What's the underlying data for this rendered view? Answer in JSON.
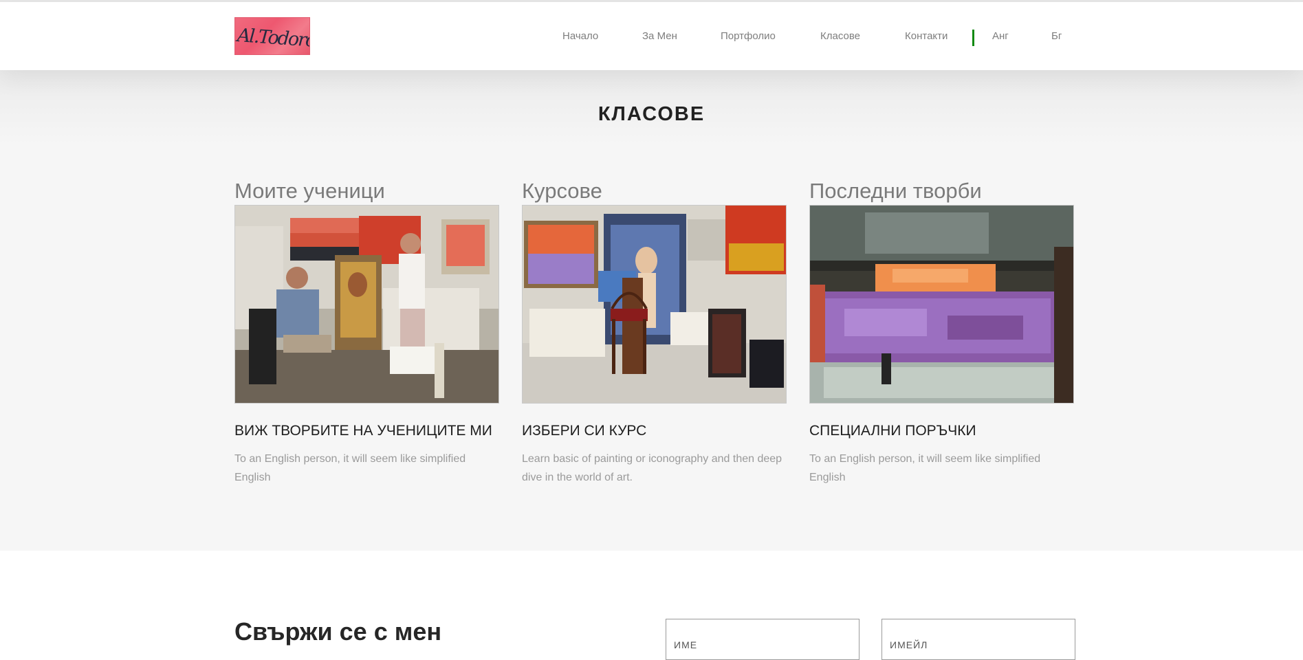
{
  "header": {
    "logo_text": "Al.Todorov",
    "nav": [
      "Начало",
      "За Мен",
      "Портфолио",
      "Класове",
      "Контакти",
      "Анг",
      "Бг"
    ]
  },
  "classes": {
    "title": "КЛАСОВЕ",
    "cards": [
      {
        "title": "Моите ученици",
        "image": "students-studio-photo",
        "heading": "ВИЖ ТВОРБИТЕ НА УЧЕНИЦИТЕ МИ",
        "text": "To an English person, it will seem like simplified English"
      },
      {
        "title": "Курсове",
        "image": "art-studio-photo",
        "heading": "ИЗБЕРИ СИ КУРС",
        "text": "Learn basic of painting or iconography and then deep dive in the world of art."
      },
      {
        "title": "Последни творби",
        "image": "abstract-painting-photo",
        "heading": "СПЕЦИАЛНИ ПОРЪЧКИ",
        "text": "To an English person, it will seem like simplified English"
      }
    ]
  },
  "contact": {
    "title": "Свържи се с мен",
    "name_placeholder": "ИМЕ",
    "email_placeholder": "ИМЕЙЛ"
  },
  "colors": {
    "nav_separator": "#108a10",
    "section_background": "#f6f6f6",
    "logo_background": "#ee5870"
  }
}
